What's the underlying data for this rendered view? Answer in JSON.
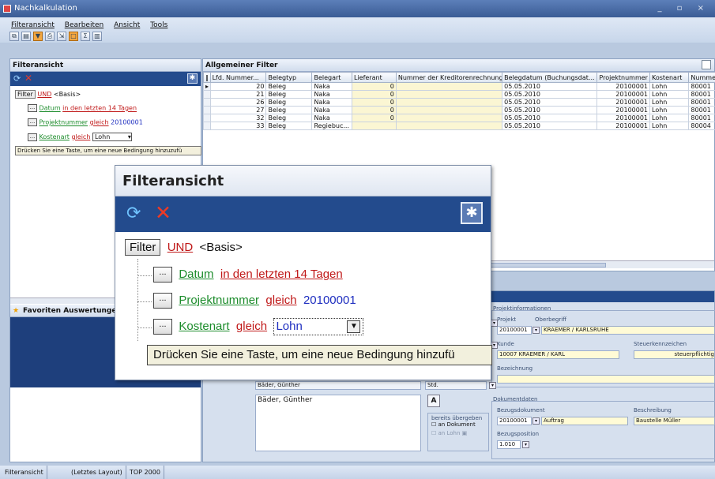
{
  "window": {
    "title": "Nachkalkulation"
  },
  "menu": [
    "Filteransicht",
    "Bearbeiten",
    "Ansicht",
    "Tools"
  ],
  "left_panel": {
    "title": "Filteransicht",
    "filter_label": "Filter",
    "und": "UND",
    "basis": "<Basis>",
    "rows": [
      {
        "field": "Datum",
        "op": "in den letzten 14 Tagen",
        "value": ""
      },
      {
        "field": "Projektnummer",
        "op": "gleich",
        "value": "20100001"
      },
      {
        "field": "Kostenart",
        "op": "gleich",
        "value": "Lohn"
      }
    ],
    "hint": "Drücken Sie eine Taste, um eine neue Bedingung hinzuzufü",
    "favorites_title": "Favoriten Auswertungen"
  },
  "grid": {
    "title": "Allgemeiner Filter",
    "columns": [
      "Lfd. Nummer...",
      "Belegtyp",
      "Belegart",
      "Lieferant",
      "Nummer der Kreditorenrechnung",
      "Belegdatum (Buchungsdat...",
      "Projektnummer",
      "Kostenart",
      "Nummer"
    ],
    "rows": [
      [
        "20",
        "Beleg",
        "Naka",
        "0",
        "",
        "05.05.2010",
        "20100001",
        "Lohn",
        "80001"
      ],
      [
        "21",
        "Beleg",
        "Naka",
        "0",
        "",
        "05.05.2010",
        "20100001",
        "Lohn",
        "80001"
      ],
      [
        "26",
        "Beleg",
        "Naka",
        "0",
        "",
        "05.05.2010",
        "20100001",
        "Lohn",
        "80001"
      ],
      [
        "27",
        "Beleg",
        "Naka",
        "0",
        "",
        "05.05.2010",
        "20100001",
        "Lohn",
        "80001"
      ],
      [
        "32",
        "Beleg",
        "Naka",
        "0",
        "",
        "05.05.2010",
        "20100001",
        "Lohn",
        "80001"
      ],
      [
        "33",
        "Beleg",
        "Regiebuc...",
        "",
        "",
        "05.05.2010",
        "20100001",
        "Lohn",
        "80004"
      ]
    ]
  },
  "detail": {
    "proj_group": "Projektinformationen",
    "projekt_lbl": "Projekt",
    "oberbegriff_lbl": "Oberbegriff",
    "projekt_val": "20100001",
    "oberbegriff_val": "KRAEMER / KARLSRUHE",
    "kunde_lbl": "Kunde",
    "steuer_lbl": "Steuerkennzeichen",
    "kunde_val": "10007 KRAEMER / KARL",
    "steuer_val": "steuerpflichtig",
    "bez_lbl": "Bezeichnung",
    "name1": "Bäder, Günther",
    "name2": "Bäder, Günther",
    "std": "Std.",
    "btn_a": "A",
    "chk_label1": "bereits übergeben",
    "chk_label2": "an Dokument",
    "chk_label3": "an Lohn",
    "dok_group": "Dokumentdaten",
    "bezdok_lbl": "Bezugsdokument",
    "beschr_lbl": "Beschreibung",
    "bezdok_val": "20100001",
    "auftrag": "Auftrag",
    "beschr_val": "Baustelle Müller",
    "bezpos_lbl": "Bezugsposition",
    "bezpos_val": "1.010",
    "cut_hn": "hn"
  },
  "zoom": {
    "title": "Filteransicht",
    "filter_label": "Filter",
    "und": "UND",
    "basis": "<Basis>",
    "rows": [
      {
        "field": "Datum",
        "op": "in den letzten 14 Tagen",
        "value": ""
      },
      {
        "field": "Projektnummer",
        "op": "gleich",
        "value": "20100001"
      },
      {
        "field": "Kostenart",
        "op": "gleich",
        "value": "Lohn"
      }
    ],
    "hint": "Drücken Sie eine Taste, um eine neue Bedingung hinzufü"
  },
  "statusbar": [
    "Filteransicht",
    "(Letztes Layout)",
    "TOP 2000"
  ]
}
